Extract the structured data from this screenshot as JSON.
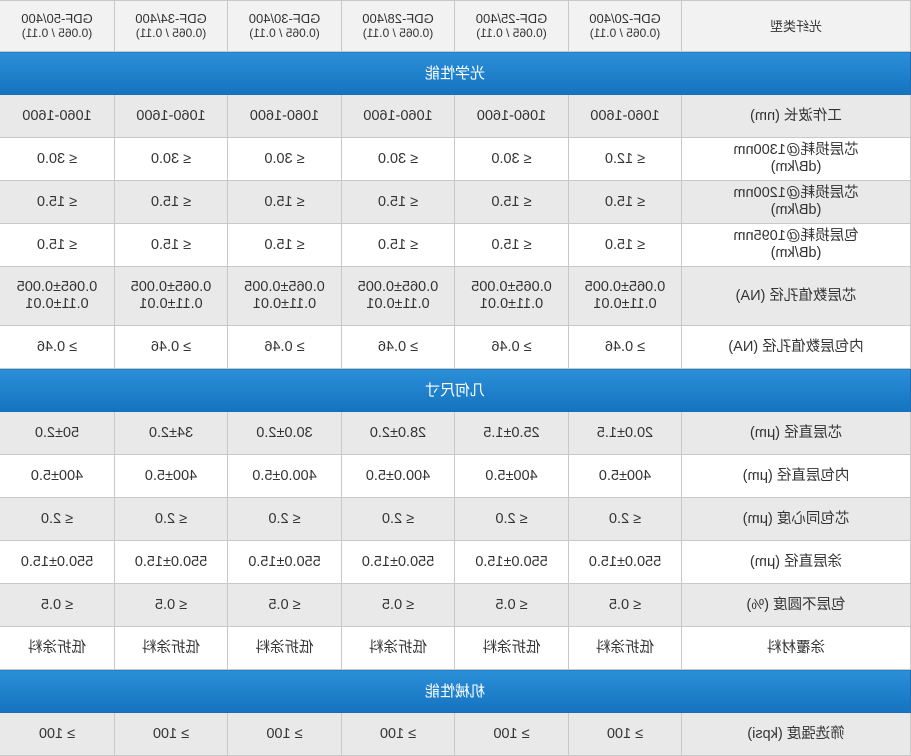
{
  "header": {
    "label": "光纤类型",
    "models": [
      {
        "name": "GDF-20/400",
        "spec": "(0.065 / 0.11)"
      },
      {
        "name": "GDF-25/400",
        "spec": "(0.065 / 0.11)"
      },
      {
        "name": "GDF-28/400",
        "spec": "(0.065 / 0.11)"
      },
      {
        "name": "GDF-30/400",
        "spec": "(0.065 / 0.11)"
      },
      {
        "name": "GDF-34/400",
        "spec": "(0.065 / 0.11)"
      },
      {
        "name": "GDF-50/400",
        "spec": "(0.065 / 0.11)"
      }
    ]
  },
  "sections": {
    "optical": "光学性能",
    "geometry": "几何尺寸",
    "mechanical": "机械性能"
  },
  "rows": {
    "wavelength": {
      "label": "工作波长 (nm)",
      "values": [
        "1060-1600",
        "1060-1600",
        "1060-1600",
        "1060-1600",
        "1060-1600",
        "1060-1600"
      ]
    },
    "core_loss_1300": {
      "label1": "芯层损耗@1300nm",
      "label2": "(dB/km)",
      "values": [
        "≤ 12.0",
        "≤ 30.0",
        "≤ 30.0",
        "≤ 30.0",
        "≤ 30.0",
        "≤ 30.0"
      ]
    },
    "core_loss_1200": {
      "label1": "芯层损耗@1200nm",
      "label2": "(dB/km)",
      "values": [
        "≤ 15.0",
        "≤ 15.0",
        "≤ 15.0",
        "≤ 15.0",
        "≤ 15.0",
        "≤ 15.0"
      ]
    },
    "clad_loss_1095": {
      "label1": "包层损耗@1095nm",
      "label2": "(dB/km)",
      "values": [
        "≤ 15.0",
        "≤ 15.0",
        "≤ 15.0",
        "≤ 15.0",
        "≤ 15.0",
        "≤ 15.0"
      ]
    },
    "core_na": {
      "label": "芯层数值孔径 (NA)",
      "line1": "0.065±0.005",
      "line2": "0.11±0.01"
    },
    "inner_clad_na": {
      "label": "内包层数值孔径 (NA)",
      "values": [
        "≥ 0.46",
        "≥ 0.46",
        "≥ 0.46",
        "≥ 0.46",
        "≥ 0.46",
        "≥ 0.46"
      ]
    },
    "core_diameter": {
      "label": "芯层直径 (μm)",
      "values": [
        "20.0±1.5",
        "25.0±1.5",
        "28.0±2.0",
        "30.0±2.0",
        "34±2.0",
        "50±2.0"
      ]
    },
    "inner_clad_diameter": {
      "label": "内包层直径 (μm)",
      "values": [
        "400±5.0",
        "400±5.0",
        "400.0±5.0",
        "400.0±5.0",
        "400±5.0",
        "400±5.0"
      ]
    },
    "concentricity": {
      "label": "芯包同心度 (μm)",
      "values": [
        "≤ 2.0",
        "≤ 2.0",
        "≤ 2.0",
        "≤ 2.0",
        "≤ 2.0",
        "≤ 2.0"
      ]
    },
    "coating_diameter": {
      "label": "涂层直径 (μm)",
      "values": [
        "550.0±15.0",
        "550.0±15.0",
        "550.0±15.0",
        "550.0±15.0",
        "550.0±15.0",
        "550.0±15.0"
      ]
    },
    "clad_noncircularity": {
      "label": "包层不圆度 (%)",
      "values": [
        "≤ 0.5",
        "≤ 0.5",
        "≤ 0.5",
        "≤ 0.5",
        "≤ 0.5",
        "≤ 0.5"
      ]
    },
    "coating_material": {
      "label": "涂覆材料",
      "values": [
        "低折涂料",
        "低折涂料",
        "低折涂料",
        "低折涂料",
        "低折涂料",
        "低折涂料"
      ]
    },
    "proof_strength": {
      "label": "筛选强度 (kpsi)",
      "values": [
        "≥ 100",
        "≥ 100",
        "≥ 100",
        "≥ 100",
        "≥ 100",
        "≥ 100"
      ]
    }
  },
  "colors": {
    "section_header": "#1573bf",
    "row_gray": "#e9e9e9",
    "row_white": "#ffffff",
    "border": "#c8c8c8"
  }
}
